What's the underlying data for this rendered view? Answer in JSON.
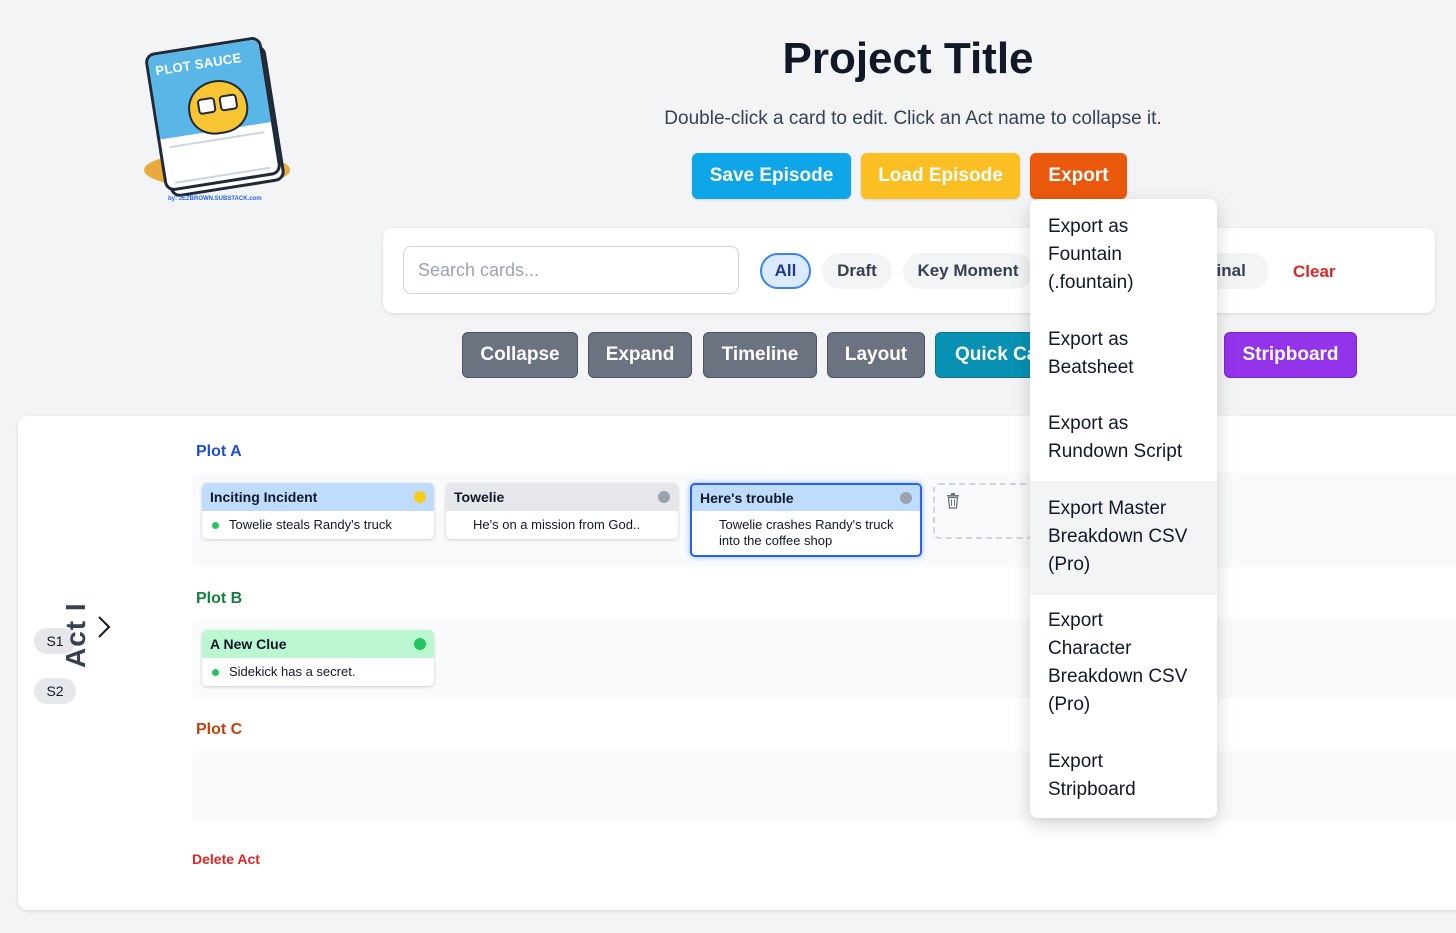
{
  "logo": {
    "title": "PLOT SAUCE",
    "byline": "by: JEZBROWN.SUBSTACK.com"
  },
  "header": {
    "title": "Project Title",
    "subtitle": "Double-click a card to edit. Click an Act name to collapse it."
  },
  "actions": {
    "save": "Save Episode",
    "load": "Load Episode",
    "export": "Export"
  },
  "filters": {
    "search_placeholder": "Search cards...",
    "pills": [
      "All",
      "Draft",
      "Key Moment",
      "Final"
    ],
    "clear": "Clear"
  },
  "toolbar": {
    "collapse": "Collapse",
    "expand": "Expand",
    "timeline": "Timeline",
    "layout": "Layout",
    "quick": "Quick Ca",
    "stripboard": "Stripboard"
  },
  "act": {
    "name": "Act I",
    "scenes": [
      "S1",
      "S2"
    ],
    "delete_label": "Delete Act",
    "plots": [
      {
        "name": "Plot A",
        "color": "#1d4ed8",
        "cards": [
          {
            "title": "Inciting Incident",
            "text": "Towelie steals Randy's truck",
            "header_color": "#bfdbfe",
            "status_color": "#facc15",
            "bullet": true
          },
          {
            "title": "Towelie",
            "text": "He's on a mission from God..",
            "header_color": "#e5e7eb",
            "status_color": "#9ca3af",
            "bullet": false
          },
          {
            "title": "Here's trouble",
            "text": "Towelie crashes Randy's truck into the coffee shop",
            "header_color": "#bfdbfe",
            "status_color": "#9ca3af",
            "bullet": false
          }
        ]
      },
      {
        "name": "Plot B",
        "color": "#15803d",
        "cards": [
          {
            "title": "A New Clue",
            "text": "Sidekick has a secret.",
            "header_color": "#bbf7d0",
            "status_color": "#22c55e",
            "bullet": true
          }
        ]
      },
      {
        "name": "Plot C",
        "color": "#c2410c",
        "cards": []
      }
    ]
  },
  "export_menu": {
    "items": [
      [
        "Export as",
        "Fountain",
        "(.fountain)"
      ],
      [
        "Export as",
        "Beatsheet"
      ],
      [
        "Export as",
        "Rundown Script"
      ],
      [
        "Export Master",
        "Breakdown CSV",
        "(Pro)"
      ],
      [
        "Export",
        "Character",
        "Breakdown CSV",
        "(Pro)"
      ],
      [
        "Export",
        "Stripboard"
      ]
    ]
  },
  "colors": {
    "save": "#0ea5e9",
    "load": "#fbbf24",
    "export": "#ea580c",
    "quick": "#0891b2",
    "stripboard": "#9333ea"
  }
}
